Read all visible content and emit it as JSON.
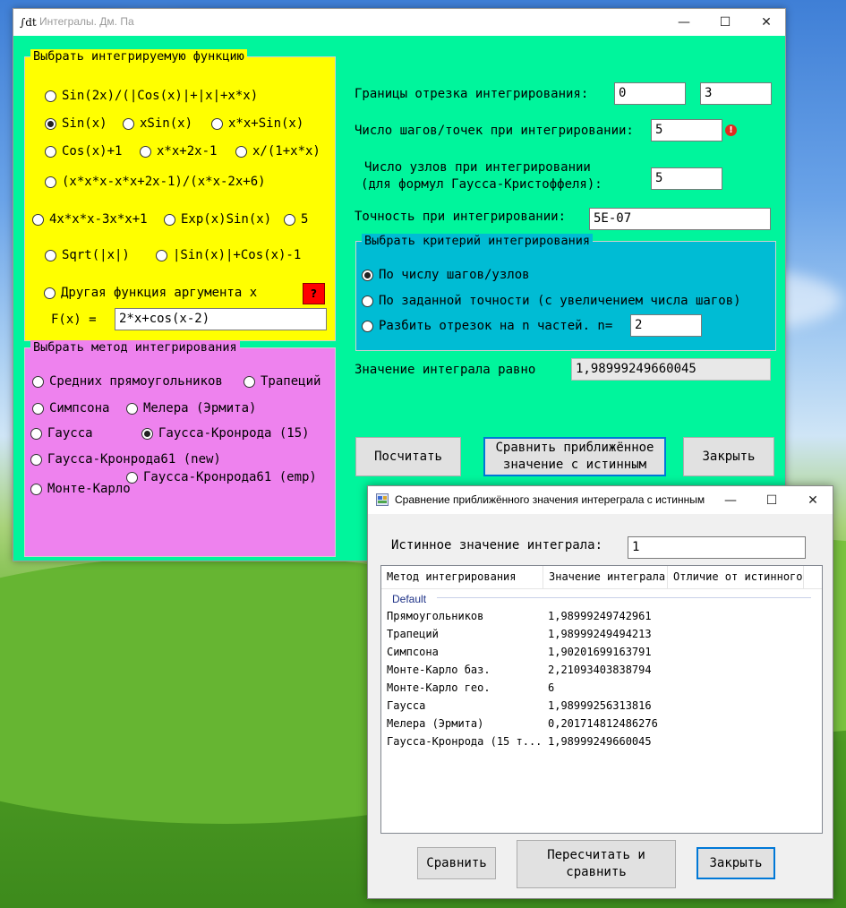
{
  "main_window": {
    "title": "Интегралы. Дм. Па",
    "title_icon": "∫dt",
    "controls": {
      "minimize": "—",
      "maximize": "☐",
      "close": "✕"
    }
  },
  "function_group": {
    "title": "Выбрать интегрируемую функцию",
    "options": [
      {
        "label": "Sin(2x)/(|Cos(x)|+|x|+x*x)",
        "checked": false
      },
      {
        "label": "Sin(x)",
        "checked": true
      },
      {
        "label": "xSin(x)",
        "checked": false
      },
      {
        "label": "x*x+Sin(x)",
        "checked": false
      },
      {
        "label": "Cos(x)+1",
        "checked": false
      },
      {
        "label": "x*x+2x-1",
        "checked": false
      },
      {
        "label": "x/(1+x*x)",
        "checked": false
      },
      {
        "label": "(x*x*x-x*x+2x-1)/(x*x-2x+6)",
        "checked": false
      },
      {
        "label": "4x*x*x-3x*x+1",
        "checked": false
      },
      {
        "label": "Exp(x)Sin(x)",
        "checked": false
      },
      {
        "label": "5",
        "checked": false
      },
      {
        "label": "Sqrt(|x|)",
        "checked": false
      },
      {
        "label": "|Sin(x)|+Cos(x)-1",
        "checked": false
      },
      {
        "label": "Другая функция аргумента x",
        "checked": false
      }
    ],
    "help_button": "?",
    "fx_label": "F(x) =",
    "fx_value": "2*x+cos(x-2)"
  },
  "method_group": {
    "title": "Выбрать метод интегрирования",
    "options": [
      {
        "label": "Средних прямоугольников",
        "checked": false
      },
      {
        "label": "Трапеций",
        "checked": false
      },
      {
        "label": "Симпсона",
        "checked": false
      },
      {
        "label": "Мелера (Эрмита)",
        "checked": false
      },
      {
        "label": "Гаусса",
        "checked": false
      },
      {
        "label": "Гаусса-Кронрода (15)",
        "checked": true
      },
      {
        "label": "Гаусса-Кронрода61 (new)",
        "checked": false
      },
      {
        "label": "Гаусса-Кронрода61 (emp)",
        "checked": false
      },
      {
        "label": "Монте-Карло",
        "checked": false
      }
    ]
  },
  "bounds": {
    "label": "Границы отрезка интегрирования:",
    "from": "0",
    "to": "3"
  },
  "steps": {
    "label": "Число шагов/точек при интегрировании:",
    "value": "5",
    "error_icon": "!"
  },
  "nodes": {
    "label_line1": "Число узлов при интегрировании",
    "label_line2": "(для формул Гаусса-Кристоффеля):",
    "value": "5"
  },
  "precision": {
    "label": "Точность при интегрировании:",
    "value": "5E-07"
  },
  "criterion_group": {
    "title": "Выбрать критерий интегрирования",
    "options": [
      {
        "label": "По числу шагов/узлов",
        "checked": true
      },
      {
        "label": "По заданной точности (с увеличением числа шагов)",
        "checked": false
      },
      {
        "label": "Разбить отрезок на n частей. n=",
        "checked": false
      }
    ],
    "n_value": "2"
  },
  "result": {
    "label": "Значение интеграла равно",
    "value": "1,98999249660045"
  },
  "buttons": {
    "calculate": "Посчитать",
    "compare_line1": "Сравнить приближённое",
    "compare_line2": "значение с истинным",
    "close": "Закрыть"
  },
  "compare_dialog": {
    "title": "Сравнение приближённого значения интерегрaла с истинным",
    "controls": {
      "minimize": "—",
      "maximize": "☐",
      "close": "✕"
    },
    "true_value_label": "Истинное значение интеграла:",
    "true_value": "1",
    "columns": [
      "Метод интегрирования",
      "Значение интеграла",
      "Отличие от истинного"
    ],
    "group_label": "Default",
    "rows": [
      {
        "method": "Прямоугольников",
        "value": "1,98999249742961"
      },
      {
        "method": "Трапеций",
        "value": "1,98999249494213"
      },
      {
        "method": "Симпсона",
        "value": "1,90201699163791"
      },
      {
        "method": "Монте-Карло баз.",
        "value": "2,21093403838794"
      },
      {
        "method": "Монте-Карло гео.",
        "value": "6"
      },
      {
        "method": "Гаусса",
        "value": "1,98999256313816"
      },
      {
        "method": "Мелера (Эрмита)",
        "value": "0,201714812486276"
      },
      {
        "method": "Гаусса-Кронрода (15 т...",
        "value": "1,98999249660045"
      }
    ],
    "buttons": {
      "compare": "Сравнить",
      "recalc_line1": "Пересчитать и",
      "recalc_line2": "сравнить",
      "close": "Закрыть"
    }
  }
}
